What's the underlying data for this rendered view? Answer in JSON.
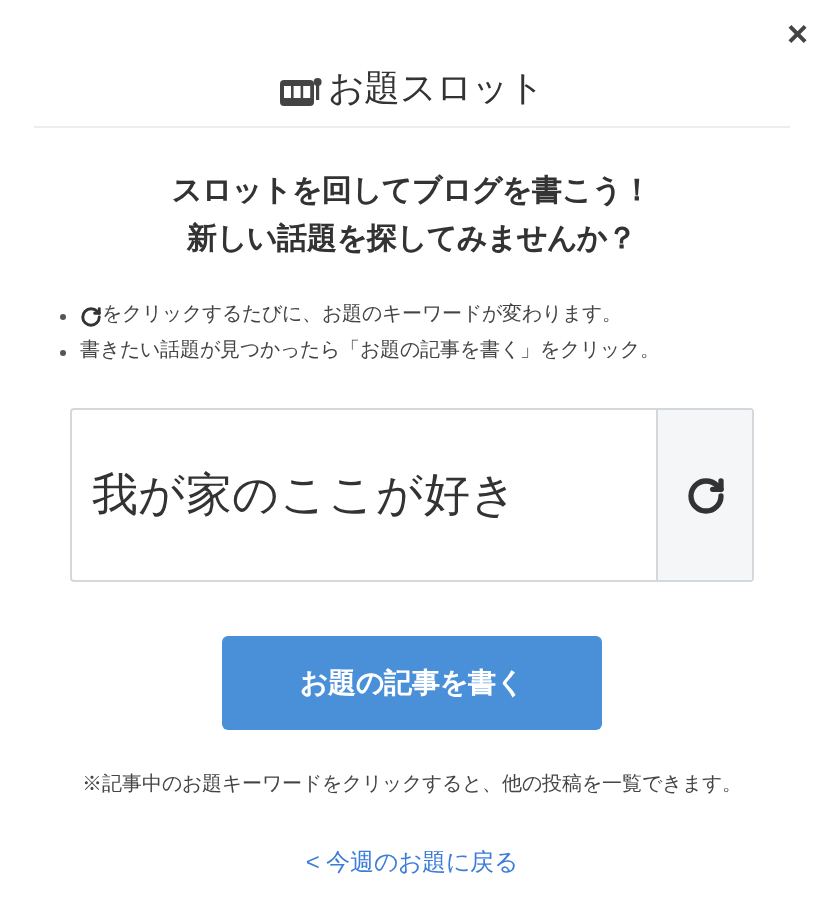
{
  "dialog": {
    "close": "×",
    "title": "お題スロット"
  },
  "heading": [
    "スロットを回してブログを書こう！",
    "新しい話題を探してみませんか？"
  ],
  "hints": [
    {
      "kind": "reload",
      "text": "をクリックするたびに、お題のキーワードが変わります。"
    },
    {
      "kind": "text",
      "text": "書きたい話題が見つかったら「お題の記事を書く」をクリック。"
    }
  ],
  "topic": {
    "value": "我が家のここが好き"
  },
  "write_button": "お題の記事を書く",
  "footnote": "※記事中のお題キーワードをクリックすると、他の投稿を一覧できます。",
  "back_link": "< 今週のお題に戻る"
}
